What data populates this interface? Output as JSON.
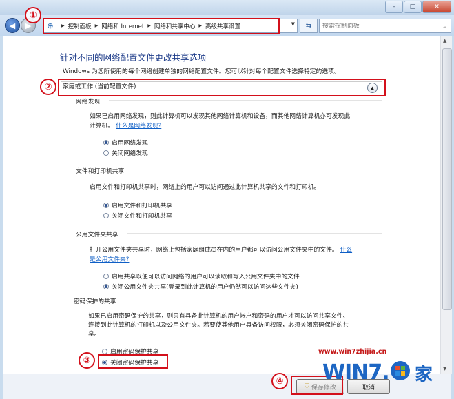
{
  "window": {
    "minimize": "–",
    "maximize": "□",
    "close": "✕"
  },
  "nav": {
    "breadcrumbs": [
      "控制面板",
      "网络和 Internet",
      "网络和共享中心",
      "高级共享设置"
    ],
    "search_placeholder": "搜索控制面板"
  },
  "page": {
    "heading": "针对不同的网络配置文件更改共享选项",
    "subtitle": "Windows 为您所使用的每个网络创建单独的网络配置文件。您可以针对每个配置文件选择特定的选项。",
    "group_title": "家庭或工作 (当前配置文件)"
  },
  "sections": {
    "discovery": {
      "title": "网络发现",
      "desc1": "如果已启用网络发现，则此计算机可以发现其他网络计算机和设备，而其他网络计算机亦可发现此",
      "desc2": "计算机。",
      "link": "什么是网络发现?",
      "on": "启用网络发现",
      "off": "关闭网络发现"
    },
    "file_printer": {
      "title": "文件和打印机共享",
      "desc": "启用文件和打印机共享时，网络上的用户可以访问通过此计算机共享的文件和打印机。",
      "on": "启用文件和打印机共享",
      "off": "关闭文件和打印机共享"
    },
    "public_folder": {
      "title": "公用文件夹共享",
      "desc1": "打开公用文件夹共享时，网络上包括家庭组成员在内的用户都可以访问公用文件夹中的文件。",
      "link1": "什么",
      "link2": "是公用文件夹?",
      "on": "启用共享以便可以访问网络的用户可以读取和写入公用文件夹中的文件",
      "off": "关闭公用文件夹共享(登录到此计算机的用户仍然可以访问这些文件夹)"
    },
    "password": {
      "title": "密码保护的共享",
      "desc1": "如果已启用密码保护的共享，则只有具备此计算机的用户帐户和密码的用户才可以访问共享文件、",
      "desc2": "连接到此计算机的打印机以及公用文件夹。若要使其他用户具备访问权限，必须关闭密码保护的共",
      "desc3": "享。",
      "on": "启用密码保护共享",
      "off": "关闭密码保护共享"
    }
  },
  "footer": {
    "save": "保存修改",
    "cancel": "取消"
  },
  "callouts": [
    "①",
    "②",
    "③",
    "④"
  ],
  "watermark": {
    "url": "www.win7zhijia.cn",
    "logo": "WIN7.",
    "jia": "家"
  },
  "colors": {
    "accent": "#1f3d8a",
    "link": "#0f5fc6",
    "annotation": "#d3101b"
  }
}
